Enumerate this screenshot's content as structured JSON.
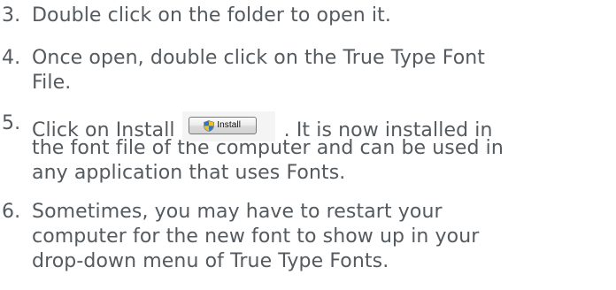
{
  "steps": [
    {
      "number": "3.",
      "lines": [
        "Double click on the folder to open it."
      ]
    },
    {
      "number": "4.",
      "lines": [
        "Once open, double click on the True Type Font",
        "File."
      ]
    },
    {
      "number": "5.",
      "prefix": "Click on Install",
      "suffix": ". It is now installed in",
      "lines": [
        "the font file of the computer and can be used in",
        "any application that uses Fonts."
      ]
    },
    {
      "number": "6.",
      "lines": [
        "Sometimes, you may have to restart your",
        "computer for the new font to show up in your",
        "drop-down menu of True Type Fonts."
      ]
    }
  ],
  "install_button": {
    "label": "Install",
    "icon": "uac-shield-icon"
  },
  "colors": {
    "text": "#555a5f"
  }
}
